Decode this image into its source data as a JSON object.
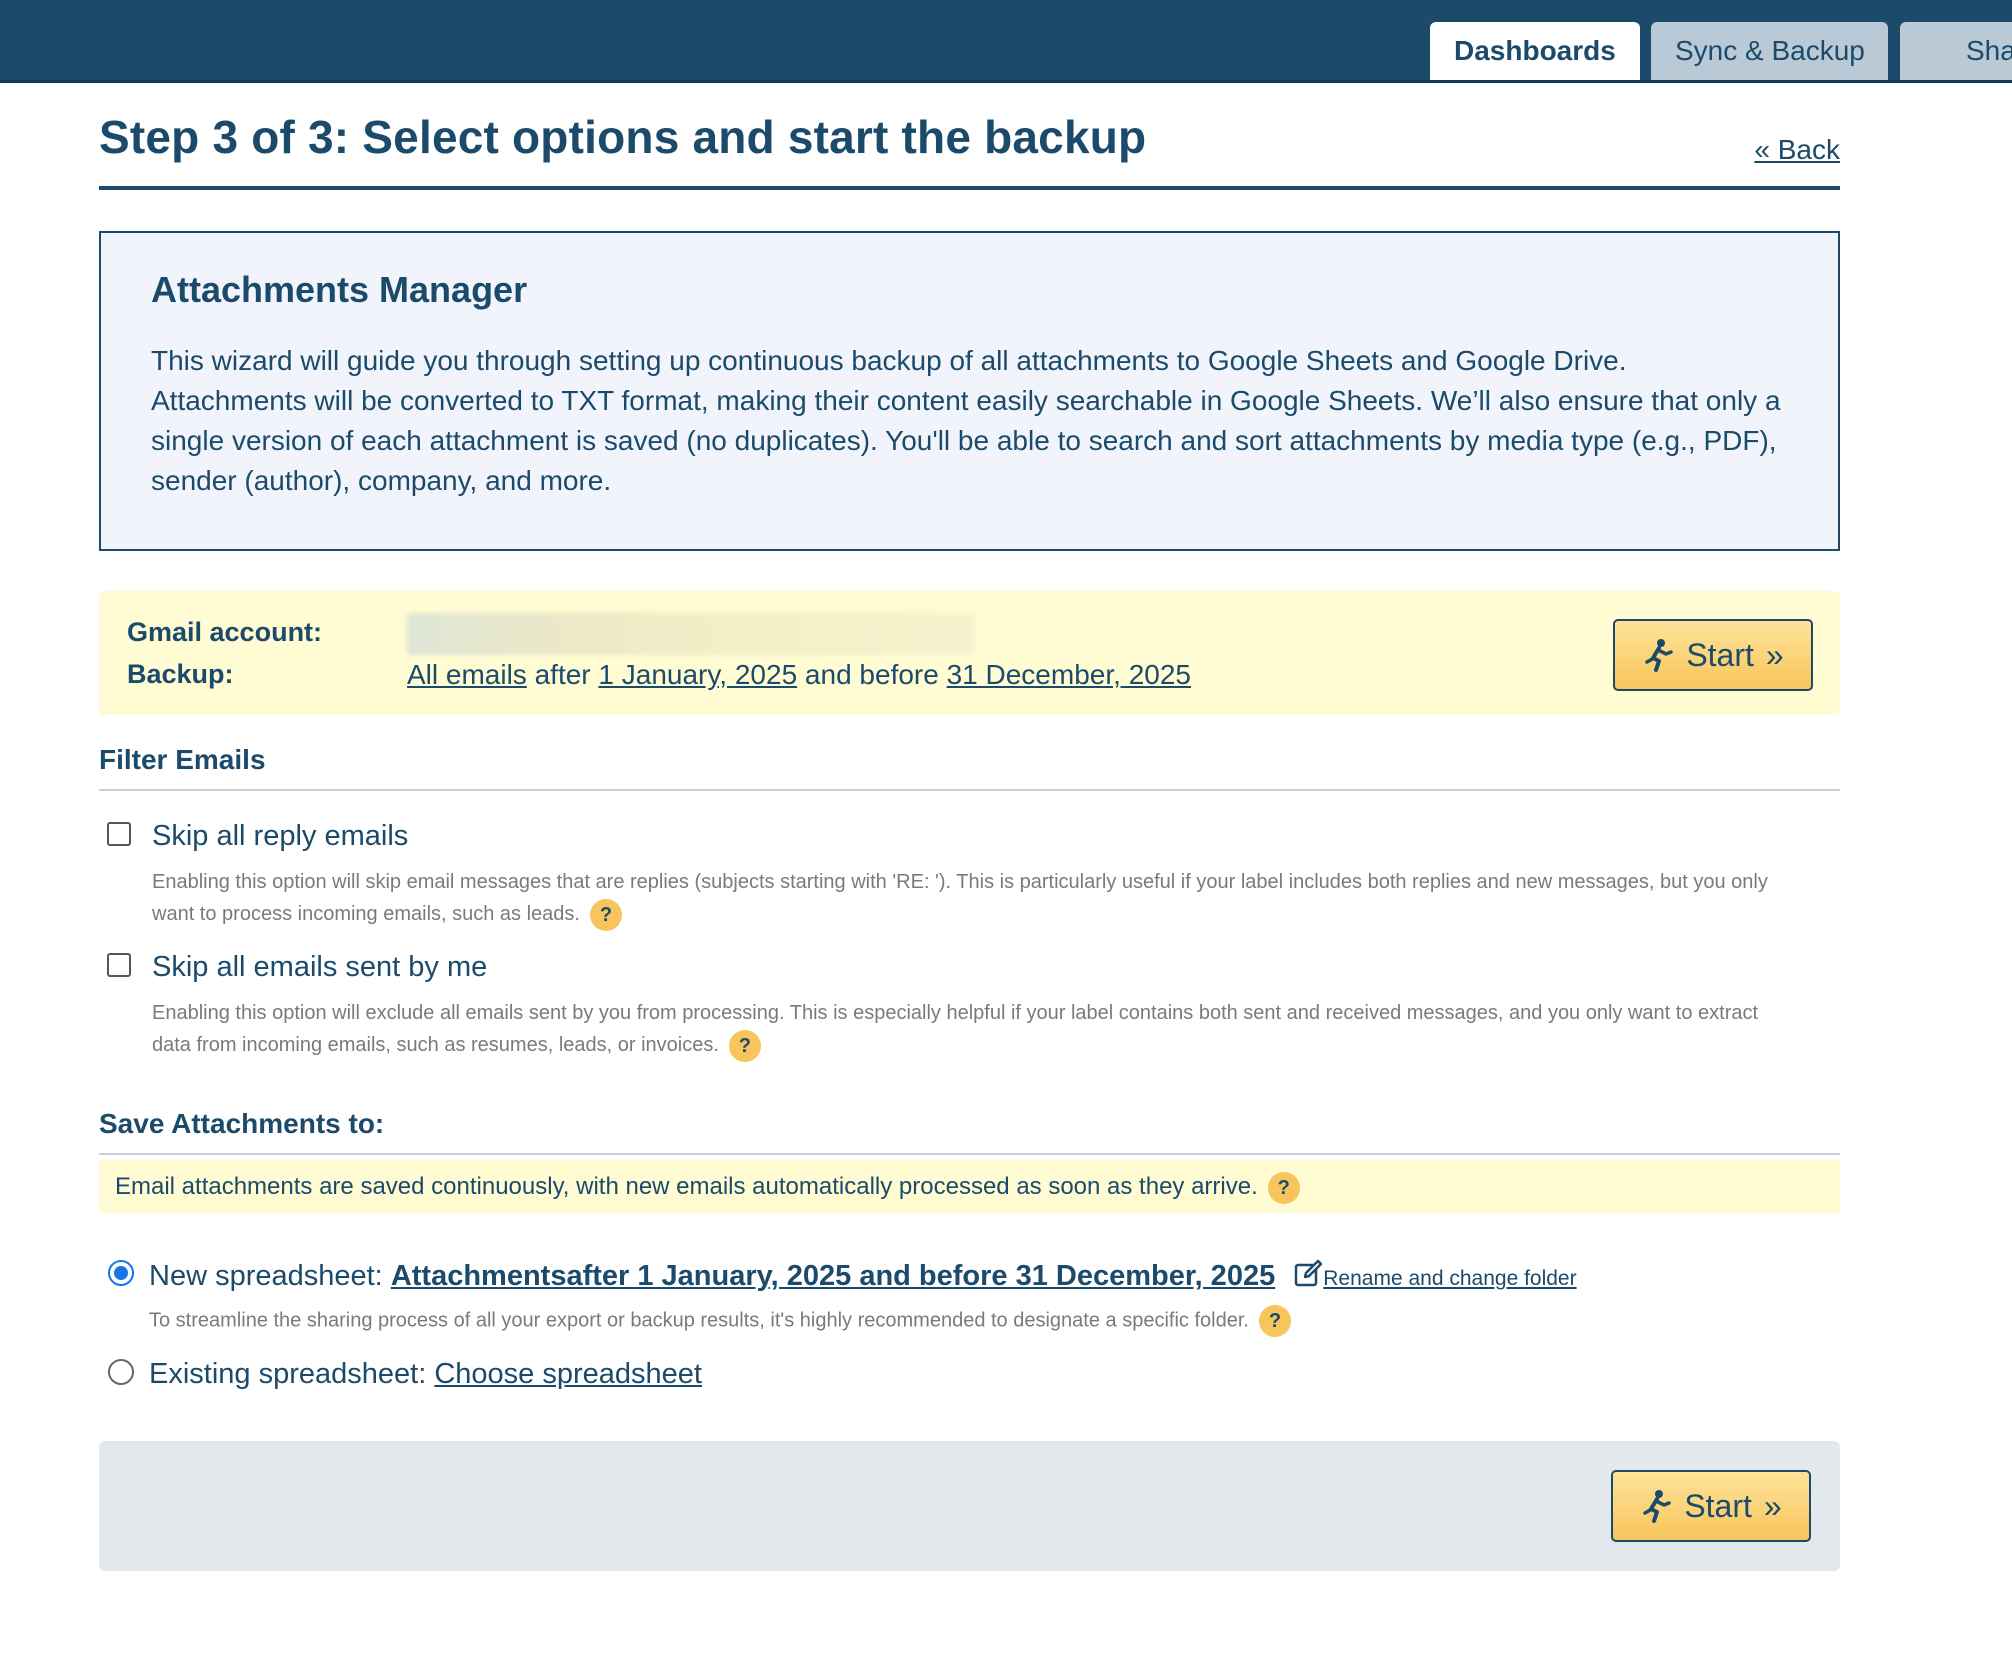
{
  "tabs": [
    {
      "label": "Dashboards",
      "active": true
    },
    {
      "label": "Sync & Backup",
      "active": false
    },
    {
      "label": "Sha",
      "active": false
    }
  ],
  "header": {
    "title": "Step 3 of 3: Select options and start the backup",
    "back_label": "« Back"
  },
  "info": {
    "heading": "Attachments Manager",
    "body": "This wizard will guide you through setting up continuous backup of all attachments to Google Sheets and Google Drive. Attachments will be converted to TXT format, making their content easily searchable in Google Sheets. We’ll also ensure that only a single version of each attachment is saved (no duplicates). You'll be able to search and sort attachments by media type (e.g., PDF), sender (author), company, and more."
  },
  "account": {
    "gmail_label": "Gmail account:",
    "backup_label": "Backup:",
    "backup_scope": "All emails",
    "after_word": "after",
    "start_date": "1 January, 2025",
    "and_before_word": "and before",
    "end_date": "31 December, 2025"
  },
  "start_button": {
    "label": "Start",
    "suffix": "»",
    "icon": "running-person-icon"
  },
  "filter": {
    "heading": "Filter Emails",
    "options": [
      {
        "label": "Skip all reply emails",
        "checked": false,
        "description": "Enabling this option will skip email messages that are replies (subjects starting with 'RE: '). This is particularly useful if your label includes both replies and new messages, but you only want to process incoming emails, such as leads."
      },
      {
        "label": "Skip all emails sent by me",
        "checked": false,
        "description": "Enabling this option will exclude all emails sent by you from processing. This is especially helpful if your label contains both sent and received messages, and you only want to extract data from incoming emails, such as resumes, leads, or invoices."
      }
    ]
  },
  "save": {
    "heading": "Save Attachments to:",
    "note": "Email attachments are saved continuously, with new emails automatically processed as soon as they arrive.",
    "new_label": "New spreadsheet:",
    "new_name": "Attachmentsafter 1 January, 2025 and before 31 December, 2025",
    "rename_label": "Rename and change folder",
    "new_desc": "To streamline the sharing process of all your export or backup results, it's highly recommended to designate a specific folder.",
    "existing_label": "Existing spreadsheet:",
    "existing_link": "Choose spreadsheet",
    "selected": "new"
  },
  "help_glyph": "?",
  "colors": {
    "primary": "#1b4a6b",
    "highlight": "#fffbd2",
    "button": "#f7c55b",
    "radio": "#1a73e8"
  }
}
